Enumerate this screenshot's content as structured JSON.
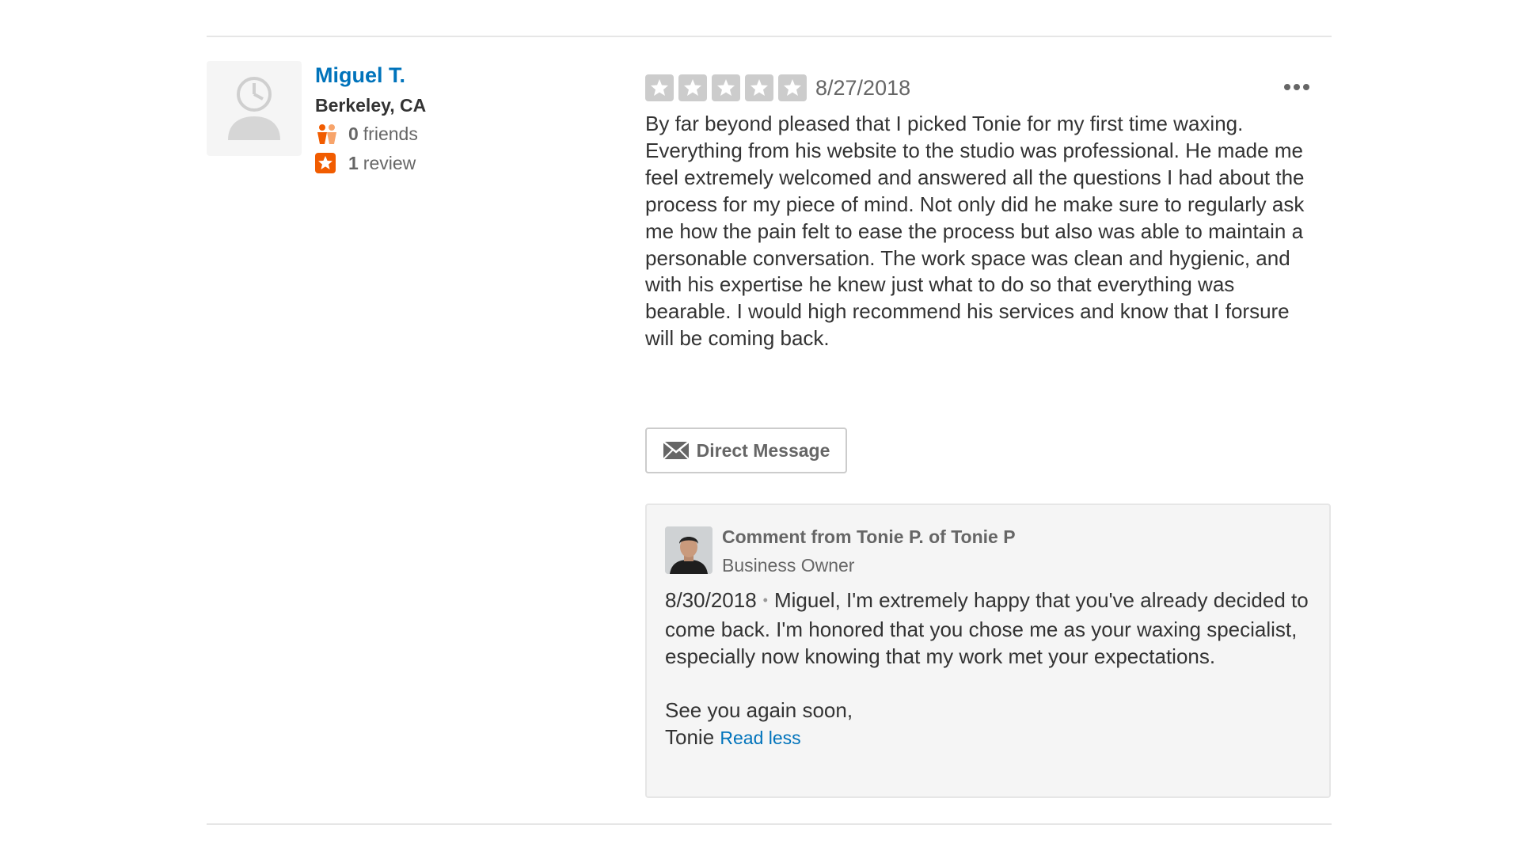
{
  "user": {
    "name": "Miguel T.",
    "location": "Berkeley, CA",
    "friends_count": "0",
    "friends_label": "friends",
    "reviews_count": "1",
    "reviews_label": "review"
  },
  "review": {
    "rating": 5,
    "date": "8/27/2018",
    "text": "By far beyond pleased that I picked Tonie for my first time waxing. Everything from his website to the studio was professional. He made me feel extremely welcomed and answered all the questions I had about the process for my piece of mind. Not only did he make sure to regularly ask me how the pain felt to ease the process but also was able to maintain a personable conversation. The work space was clean and hygienic, and with his expertise he knew just what to do so that everything was bearable. I would high recommend his services and know that I forsure will be coming back.",
    "direct_message_label": "Direct Message"
  },
  "owner_comment": {
    "title": "Comment from Tonie P. of Tonie P",
    "role": "Business Owner",
    "date": "8/30/2018",
    "separator": "•",
    "paragraph1": "Miguel, I'm extremely happy that you've already decided to come back. I'm honored that you chose me as your waxing specialist, especially now knowing that my work met your expectations.",
    "paragraph2": "See you again soon,",
    "signature": "Tonie",
    "read_less_label": "Read less"
  },
  "colors": {
    "link": "#0073bb",
    "star_inactive": "#cccccc",
    "friends_icon": "#f15c00",
    "review_icon": "#f15c00"
  },
  "icons": {
    "avatar": "default-user-avatar-icon",
    "friends": "friends-icon",
    "reviews": "star-badge-icon",
    "more": "ellipsis-icon",
    "message": "envelope-icon"
  }
}
